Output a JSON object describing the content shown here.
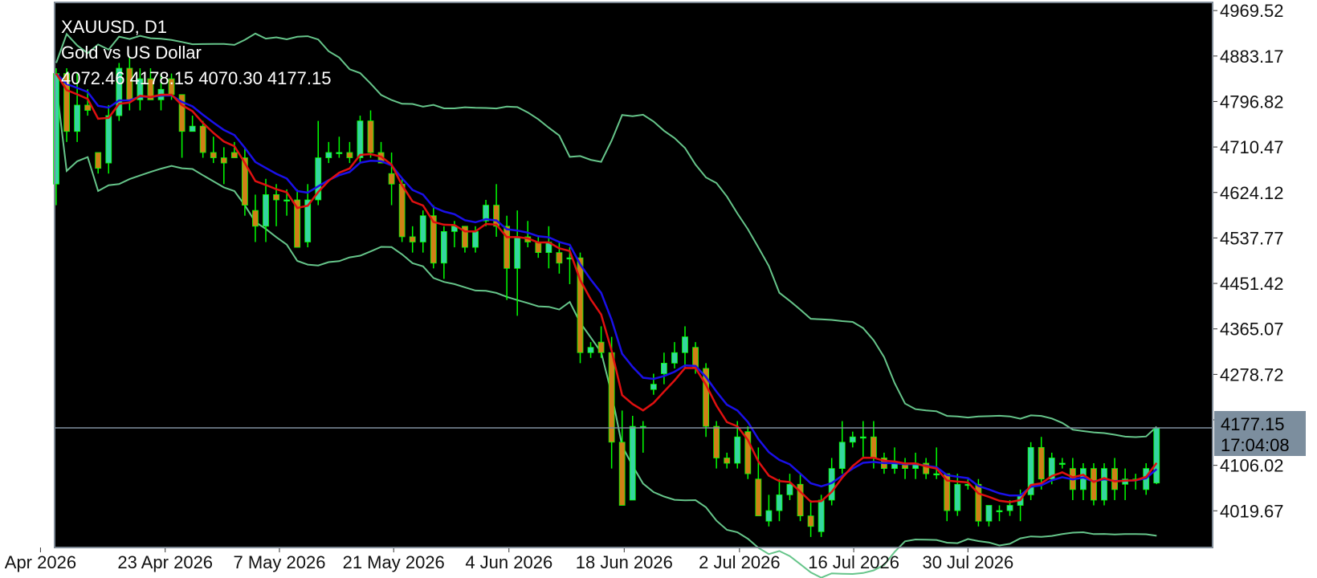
{
  "header": {
    "symbol": "XAUUSD, D1",
    "description": "Gold vs US Dollar",
    "ohlc": "4072.46 4178.15 4070.30 4177.15"
  },
  "price_label": {
    "price": "4177.15",
    "timer": "17:04:08"
  },
  "menu_icon": "more-horizontal-icon",
  "colors": {
    "background": "#000000",
    "page": "#ffffff",
    "frame": "#7f8a96",
    "bull": "#35d6a0",
    "bear": "#d08016",
    "wick": "#00ff00",
    "bands": "#66c58a",
    "ma_fast": "#e01010",
    "ma_slow": "#1a10e8",
    "price_line": "#8090a0",
    "label_bg": "#7c8e9e",
    "text": "#ffffff",
    "axis_text": "#111111"
  },
  "chart_data": {
    "type": "candlestick",
    "symbol": "XAUUSD",
    "timeframe": "D1",
    "ylim": [
      3950,
      4985
    ],
    "y_ticks": [
      "4969.52",
      "4883.17",
      "4796.82",
      "4710.47",
      "4624.12",
      "4537.77",
      "4451.42",
      "4365.07",
      "4278.72",
      "4192.37",
      "4106.02",
      "4019.67"
    ],
    "y_tick_values": [
      4969.52,
      4883.17,
      4796.82,
      4710.47,
      4624.12,
      4537.77,
      4451.42,
      4365.07,
      4278.72,
      4192.37,
      4106.02,
      4019.67
    ],
    "x_ticks": [
      "Apr 2026",
      "23 Apr 2026",
      "7 May 2026",
      "21 May 2026",
      "4 Jun 2026",
      "18 Jun 2026",
      "2 Jul 2026",
      "16 Jul 2026",
      "30 Jul 2026"
    ],
    "x_tick_index": [
      -1.5,
      10.4,
      21.3,
      32.2,
      43.2,
      54.2,
      65.2,
      76.1,
      87
    ],
    "last_price": 4177.15,
    "candles": [
      [
        4640,
        4860,
        4600,
        4850
      ],
      [
        4850,
        4860,
        4720,
        4740
      ],
      [
        4740,
        4850,
        4720,
        4790
      ],
      [
        4790,
        4820,
        4770,
        4780
      ],
      [
        4700,
        4690,
        4660,
        4670
      ],
      [
        4680,
        4790,
        4660,
        4770
      ],
      [
        4770,
        4870,
        4760,
        4860
      ],
      [
        4860,
        4880,
        4780,
        4800
      ],
      [
        4800,
        4860,
        4780,
        4840
      ],
      [
        4840,
        4860,
        4800,
        4800
      ],
      [
        4800,
        4850,
        4780,
        4820
      ],
      [
        4840,
        4850,
        4800,
        4810
      ],
      [
        4810,
        4800,
        4690,
        4740
      ],
      [
        4740,
        4770,
        4740,
        4750
      ],
      [
        4750,
        4760,
        4690,
        4700
      ],
      [
        4700,
        4730,
        4680,
        4690
      ],
      [
        4690,
        4710,
        4640,
        4680
      ],
      [
        4700,
        4720,
        4690,
        4690
      ],
      [
        4690,
        4710,
        4580,
        4600
      ],
      [
        4590,
        4620,
        4530,
        4560
      ],
      [
        4560,
        4650,
        4530,
        4620
      ],
      [
        4620,
        4640,
        4560,
        4610
      ],
      [
        4610,
        4630,
        4580,
        4610
      ],
      [
        4610,
        4630,
        4520,
        4520
      ],
      [
        4530,
        4640,
        4520,
        4610
      ],
      [
        4610,
        4760,
        4600,
        4690
      ],
      [
        4690,
        4720,
        4680,
        4700
      ],
      [
        4700,
        4730,
        4690,
        4700
      ],
      [
        4700,
        4720,
        4680,
        4690
      ],
      [
        4690,
        4770,
        4680,
        4760
      ],
      [
        4760,
        4780,
        4690,
        4700
      ],
      [
        4700,
        4720,
        4680,
        4680
      ],
      [
        4660,
        4700,
        4600,
        4640
      ],
      [
        4640,
        4650,
        4530,
        4540
      ],
      [
        4540,
        4560,
        4510,
        4530
      ],
      [
        4530,
        4590,
        4510,
        4580
      ],
      [
        4580,
        4600,
        4480,
        4490
      ],
      [
        4490,
        4560,
        4460,
        4550
      ],
      [
        4550,
        4570,
        4520,
        4560
      ],
      [
        4560,
        4560,
        4510,
        4520
      ],
      [
        4520,
        4560,
        4510,
        4550
      ],
      [
        4570,
        4610,
        4560,
        4600
      ],
      [
        4600,
        4640,
        4540,
        4560
      ],
      [
        4560,
        4580,
        4420,
        4480
      ],
      [
        4480,
        4590,
        4390,
        4540
      ],
      [
        4540,
        4570,
        4520,
        4530
      ],
      [
        4530,
        4540,
        4500,
        4510
      ],
      [
        4510,
        4560,
        4480,
        4530
      ],
      [
        4510,
        4530,
        4470,
        4490
      ],
      [
        4500,
        4520,
        4450,
        4500
      ],
      [
        4500,
        4510,
        4300,
        4320
      ],
      [
        4320,
        4340,
        4310,
        4330
      ],
      [
        4340,
        4370,
        4310,
        4320
      ],
      [
        4320,
        4350,
        4100,
        4150
      ],
      [
        4150,
        4210,
        4030,
        4030
      ],
      [
        4040,
        4200,
        4040,
        4180
      ],
      [
        4180,
        4190,
        4130,
        4180
      ],
      [
        4250,
        4280,
        4240,
        4260
      ],
      [
        4280,
        4320,
        4260,
        4300
      ],
      [
        4300,
        4340,
        4290,
        4320
      ],
      [
        4320,
        4370,
        4290,
        4350
      ],
      [
        4330,
        4340,
        4280,
        4290
      ],
      [
        4290,
        4300,
        4160,
        4180
      ],
      [
        4180,
        4190,
        4100,
        4120
      ],
      [
        4120,
        4130,
        4100,
        4110
      ],
      [
        4110,
        4190,
        4100,
        4160
      ],
      [
        4170,
        4180,
        4080,
        4090
      ],
      [
        4080,
        4140,
        4010,
        4010
      ],
      [
        4000,
        4050,
        3990,
        4020
      ],
      [
        4020,
        4080,
        4000,
        4050
      ],
      [
        4050,
        4090,
        4040,
        4070
      ],
      [
        4070,
        4090,
        4000,
        4010
      ],
      [
        4010,
        4040,
        3970,
        3990
      ],
      [
        3980,
        4050,
        3970,
        4040
      ],
      [
        4040,
        4120,
        4030,
        4100
      ],
      [
        4100,
        4190,
        4090,
        4150
      ],
      [
        4150,
        4170,
        4140,
        4160
      ],
      [
        4160,
        4190,
        4120,
        4160
      ],
      [
        4160,
        4190,
        4100,
        4120
      ],
      [
        4120,
        4130,
        4090,
        4100
      ],
      [
        4100,
        4140,
        4090,
        4110
      ],
      [
        4110,
        4120,
        4080,
        4100
      ],
      [
        4100,
        4130,
        4080,
        4110
      ],
      [
        4110,
        4120,
        4080,
        4090
      ],
      [
        4090,
        4140,
        4080,
        4090
      ],
      [
        4090,
        4080,
        4000,
        4020
      ],
      [
        4020,
        4090,
        4010,
        4070
      ],
      [
        4070,
        4080,
        4060,
        4070
      ],
      [
        4070,
        4080,
        3990,
        4000
      ],
      [
        4000,
        4030,
        3990,
        4030
      ],
      [
        4020,
        4030,
        4000,
        4020
      ],
      [
        4020,
        4040,
        4010,
        4030
      ],
      [
        4030,
        4060,
        4000,
        4050
      ],
      [
        4050,
        4150,
        4040,
        4140
      ],
      [
        4140,
        4160,
        4060,
        4080
      ],
      [
        4080,
        4130,
        4070,
        4120
      ],
      [
        4110,
        4120,
        4100,
        4110
      ],
      [
        4100,
        4120,
        4040,
        4060
      ],
      [
        4060,
        4110,
        4040,
        4100
      ],
      [
        4100,
        4110,
        4030,
        4040
      ],
      [
        4040,
        4110,
        4030,
        4100
      ],
      [
        4100,
        4120,
        4040,
        4060
      ],
      [
        4070,
        4100,
        4040,
        4080
      ],
      [
        4080,
        4090,
        4060,
        4080
      ],
      [
        4060,
        4110,
        4050,
        4100
      ],
      [
        4072.46,
        4178.15,
        4070.3,
        4177.15
      ]
    ]
  }
}
